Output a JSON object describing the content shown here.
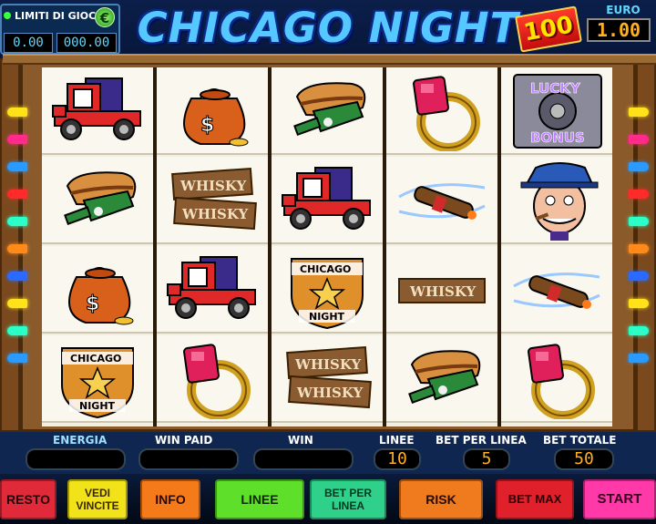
{
  "header": {
    "limits_label": "LIMITI DI GIOCO",
    "currency_icon": "€",
    "limit_box_1": "0.00",
    "limit_box_2": "000.00",
    "title": "CHICAGO NIGHT",
    "bonus_badge": "100",
    "credit_label": "EURO",
    "credit_value": "1.00"
  },
  "reels": [
    [
      "red-car",
      "hotdog-bottle",
      "money-bag",
      "chicago-night-badge"
    ],
    [
      "money-bag",
      "whisky-whisky-sign",
      "red-car",
      "ruby-ring"
    ],
    [
      "hotdog-bottle",
      "red-car",
      "chicago-night-badge",
      "whisky-whisky-sign"
    ],
    [
      "ruby-ring",
      "cigar",
      "whisky-sign",
      "hotdog-bottle"
    ],
    [
      "lucky-bonus-safe",
      "gangster-face",
      "cigar",
      "ruby-ring"
    ]
  ],
  "symbol_text": {
    "whisky": "WHISKY",
    "chicago": "CHICAGO",
    "night": "NIGHT",
    "lucky": "LUCKY",
    "bonus": "BONUS",
    "dollar": "$"
  },
  "info": {
    "energia_label": "ENERGIA",
    "energia_value": "",
    "win_paid_label": "WIN PAID",
    "win_paid_value": "",
    "win_label": "WIN",
    "win_value": "",
    "linee_label": "LINEE",
    "linee_value": "10",
    "bet_per_linea_label": "BET PER LINEA",
    "bet_per_linea_value": "5",
    "bet_totale_label": "BET TOTALE",
    "bet_totale_value": "50"
  },
  "buttons": {
    "resto": "RESTO",
    "vedi_vincite": "VEDI VINCITE",
    "info": "INFO",
    "linee": "LINEE",
    "bet_per_linea": "BET PER LINEA",
    "risk": "RISK",
    "bet_max": "BET MAX",
    "start": "START"
  },
  "colors": {
    "title": "#54c8ff",
    "frame": "#8a5a2a",
    "btn_resto": "#e02a3a",
    "btn_vedi": "#f2e21a",
    "btn_info": "#f47a1a",
    "btn_linee": "#5ee02a",
    "btn_betpl": "#2ed08a",
    "btn_risk": "#f07a1e",
    "btn_betmax": "#e0202a",
    "btn_start": "#ff3aa8"
  }
}
